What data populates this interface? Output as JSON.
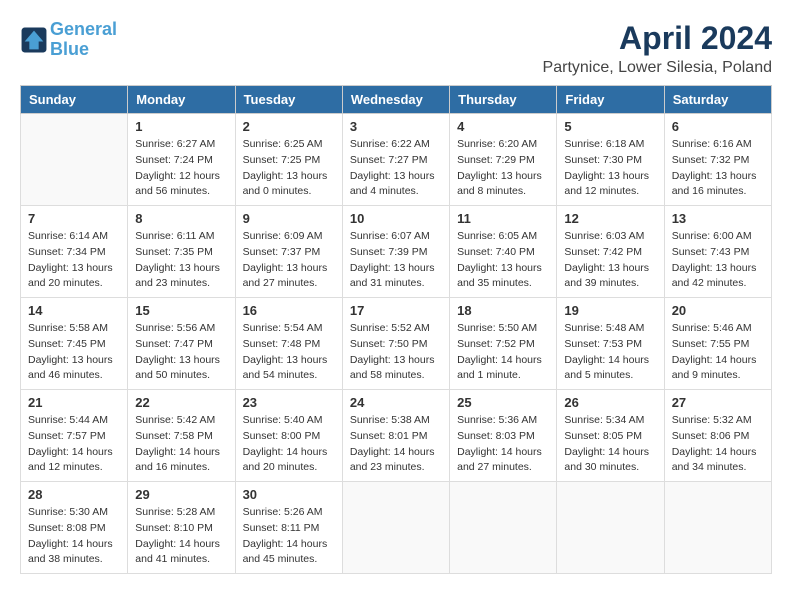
{
  "logo": {
    "general": "General",
    "blue": "Blue",
    "tagline": ""
  },
  "header": {
    "title": "April 2024",
    "subtitle": "Partynice, Lower Silesia, Poland"
  },
  "weekdays": [
    "Sunday",
    "Monday",
    "Tuesday",
    "Wednesday",
    "Thursday",
    "Friday",
    "Saturday"
  ],
  "weeks": [
    [
      {
        "day": "",
        "sunrise": "",
        "sunset": "",
        "daylight": ""
      },
      {
        "day": "1",
        "sunrise": "Sunrise: 6:27 AM",
        "sunset": "Sunset: 7:24 PM",
        "daylight": "Daylight: 12 hours and 56 minutes."
      },
      {
        "day": "2",
        "sunrise": "Sunrise: 6:25 AM",
        "sunset": "Sunset: 7:25 PM",
        "daylight": "Daylight: 13 hours and 0 minutes."
      },
      {
        "day": "3",
        "sunrise": "Sunrise: 6:22 AM",
        "sunset": "Sunset: 7:27 PM",
        "daylight": "Daylight: 13 hours and 4 minutes."
      },
      {
        "day": "4",
        "sunrise": "Sunrise: 6:20 AM",
        "sunset": "Sunset: 7:29 PM",
        "daylight": "Daylight: 13 hours and 8 minutes."
      },
      {
        "day": "5",
        "sunrise": "Sunrise: 6:18 AM",
        "sunset": "Sunset: 7:30 PM",
        "daylight": "Daylight: 13 hours and 12 minutes."
      },
      {
        "day": "6",
        "sunrise": "Sunrise: 6:16 AM",
        "sunset": "Sunset: 7:32 PM",
        "daylight": "Daylight: 13 hours and 16 minutes."
      }
    ],
    [
      {
        "day": "7",
        "sunrise": "Sunrise: 6:14 AM",
        "sunset": "Sunset: 7:34 PM",
        "daylight": "Daylight: 13 hours and 20 minutes."
      },
      {
        "day": "8",
        "sunrise": "Sunrise: 6:11 AM",
        "sunset": "Sunset: 7:35 PM",
        "daylight": "Daylight: 13 hours and 23 minutes."
      },
      {
        "day": "9",
        "sunrise": "Sunrise: 6:09 AM",
        "sunset": "Sunset: 7:37 PM",
        "daylight": "Daylight: 13 hours and 27 minutes."
      },
      {
        "day": "10",
        "sunrise": "Sunrise: 6:07 AM",
        "sunset": "Sunset: 7:39 PM",
        "daylight": "Daylight: 13 hours and 31 minutes."
      },
      {
        "day": "11",
        "sunrise": "Sunrise: 6:05 AM",
        "sunset": "Sunset: 7:40 PM",
        "daylight": "Daylight: 13 hours and 35 minutes."
      },
      {
        "day": "12",
        "sunrise": "Sunrise: 6:03 AM",
        "sunset": "Sunset: 7:42 PM",
        "daylight": "Daylight: 13 hours and 39 minutes."
      },
      {
        "day": "13",
        "sunrise": "Sunrise: 6:00 AM",
        "sunset": "Sunset: 7:43 PM",
        "daylight": "Daylight: 13 hours and 42 minutes."
      }
    ],
    [
      {
        "day": "14",
        "sunrise": "Sunrise: 5:58 AM",
        "sunset": "Sunset: 7:45 PM",
        "daylight": "Daylight: 13 hours and 46 minutes."
      },
      {
        "day": "15",
        "sunrise": "Sunrise: 5:56 AM",
        "sunset": "Sunset: 7:47 PM",
        "daylight": "Daylight: 13 hours and 50 minutes."
      },
      {
        "day": "16",
        "sunrise": "Sunrise: 5:54 AM",
        "sunset": "Sunset: 7:48 PM",
        "daylight": "Daylight: 13 hours and 54 minutes."
      },
      {
        "day": "17",
        "sunrise": "Sunrise: 5:52 AM",
        "sunset": "Sunset: 7:50 PM",
        "daylight": "Daylight: 13 hours and 58 minutes."
      },
      {
        "day": "18",
        "sunrise": "Sunrise: 5:50 AM",
        "sunset": "Sunset: 7:52 PM",
        "daylight": "Daylight: 14 hours and 1 minute."
      },
      {
        "day": "19",
        "sunrise": "Sunrise: 5:48 AM",
        "sunset": "Sunset: 7:53 PM",
        "daylight": "Daylight: 14 hours and 5 minutes."
      },
      {
        "day": "20",
        "sunrise": "Sunrise: 5:46 AM",
        "sunset": "Sunset: 7:55 PM",
        "daylight": "Daylight: 14 hours and 9 minutes."
      }
    ],
    [
      {
        "day": "21",
        "sunrise": "Sunrise: 5:44 AM",
        "sunset": "Sunset: 7:57 PM",
        "daylight": "Daylight: 14 hours and 12 minutes."
      },
      {
        "day": "22",
        "sunrise": "Sunrise: 5:42 AM",
        "sunset": "Sunset: 7:58 PM",
        "daylight": "Daylight: 14 hours and 16 minutes."
      },
      {
        "day": "23",
        "sunrise": "Sunrise: 5:40 AM",
        "sunset": "Sunset: 8:00 PM",
        "daylight": "Daylight: 14 hours and 20 minutes."
      },
      {
        "day": "24",
        "sunrise": "Sunrise: 5:38 AM",
        "sunset": "Sunset: 8:01 PM",
        "daylight": "Daylight: 14 hours and 23 minutes."
      },
      {
        "day": "25",
        "sunrise": "Sunrise: 5:36 AM",
        "sunset": "Sunset: 8:03 PM",
        "daylight": "Daylight: 14 hours and 27 minutes."
      },
      {
        "day": "26",
        "sunrise": "Sunrise: 5:34 AM",
        "sunset": "Sunset: 8:05 PM",
        "daylight": "Daylight: 14 hours and 30 minutes."
      },
      {
        "day": "27",
        "sunrise": "Sunrise: 5:32 AM",
        "sunset": "Sunset: 8:06 PM",
        "daylight": "Daylight: 14 hours and 34 minutes."
      }
    ],
    [
      {
        "day": "28",
        "sunrise": "Sunrise: 5:30 AM",
        "sunset": "Sunset: 8:08 PM",
        "daylight": "Daylight: 14 hours and 38 minutes."
      },
      {
        "day": "29",
        "sunrise": "Sunrise: 5:28 AM",
        "sunset": "Sunset: 8:10 PM",
        "daylight": "Daylight: 14 hours and 41 minutes."
      },
      {
        "day": "30",
        "sunrise": "Sunrise: 5:26 AM",
        "sunset": "Sunset: 8:11 PM",
        "daylight": "Daylight: 14 hours and 45 minutes."
      },
      {
        "day": "",
        "sunrise": "",
        "sunset": "",
        "daylight": ""
      },
      {
        "day": "",
        "sunrise": "",
        "sunset": "",
        "daylight": ""
      },
      {
        "day": "",
        "sunrise": "",
        "sunset": "",
        "daylight": ""
      },
      {
        "day": "",
        "sunrise": "",
        "sunset": "",
        "daylight": ""
      }
    ]
  ]
}
